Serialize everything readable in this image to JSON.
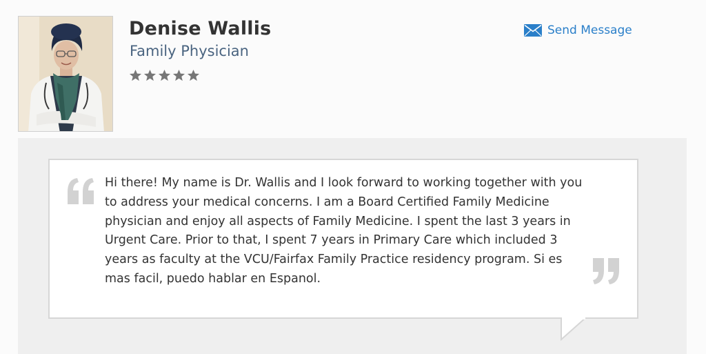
{
  "profile": {
    "name": "Denise Wallis",
    "title": "Family Physician",
    "rating": 5,
    "rating_max": 5,
    "avatar_icon": "doctor-portrait"
  },
  "actions": {
    "send_message_label": "Send Message",
    "send_message_icon": "envelope-icon"
  },
  "bio": {
    "text": "Hi there! My name is Dr. Wallis and I look forward to working together with you to address your medical concerns. I am a Board Certified Family Medicine physician and enjoy all aspects of Family Medicine. I spent the last 3 years in Urgent Care. Prior to that, I spent 7 years in Primary Care which included 3 years as faculty at the VCU/Fairfax Family Practice residency program. Si es mas facil, puedo hablar en Espanol.",
    "open_quote_icon": "open-quote-icon",
    "close_quote_icon": "close-quote-icon"
  },
  "colors": {
    "name": "#333333",
    "title": "#4a6480",
    "link": "#2a7fc9",
    "star": "#777777",
    "panel_bg": "#efefef",
    "quote_mark": "#d2d2d2"
  }
}
